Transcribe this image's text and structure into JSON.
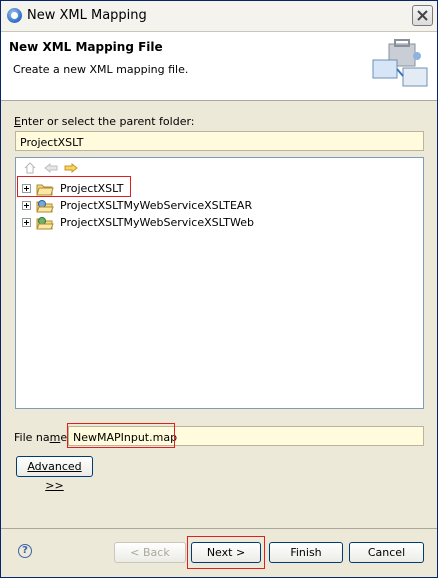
{
  "window": {
    "title": "New XML Mapping"
  },
  "banner": {
    "title": "New XML Mapping File",
    "description": "Create a new XML mapping file."
  },
  "parent_folder": {
    "label_prefix": "E",
    "label_rest": "nter or select the parent folder:",
    "value": "ProjectXSLT"
  },
  "tree": {
    "items": [
      {
        "label": "ProjectXSLT"
      },
      {
        "label": "ProjectXSLTMyWebServiceXSLTEAR"
      },
      {
        "label": "ProjectXSLTMyWebServiceXSLTWeb"
      }
    ]
  },
  "file_name": {
    "label_prefix": "File na",
    "label_u": "m",
    "label_rest": "e:",
    "value": "NewMAPInput.map"
  },
  "buttons": {
    "advanced": "Advanced >>",
    "back": "< Back",
    "next": "Next >",
    "finish": "Finish",
    "cancel": "Cancel"
  },
  "help": {
    "glyph": "?"
  }
}
